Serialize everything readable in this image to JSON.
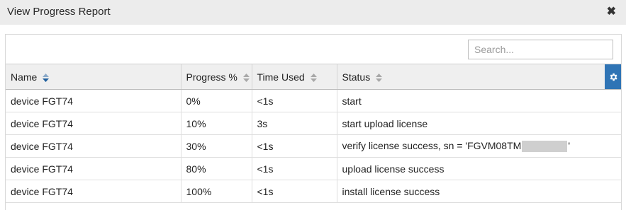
{
  "dialog": {
    "title": "View Progress Report",
    "close_glyph": "✖"
  },
  "search": {
    "placeholder": "Search..."
  },
  "table": {
    "columns": [
      "Name",
      "Progress %",
      "Time Used",
      "Status"
    ],
    "rows": [
      {
        "name": "device FGT74",
        "progress": "0%",
        "time": "<1s",
        "status": "start"
      },
      {
        "name": "device FGT74",
        "progress": "10%",
        "time": "3s",
        "status": "start upload license"
      },
      {
        "name": "device FGT74",
        "progress": "30%",
        "time": "<1s",
        "status_prefix": "verify license success, sn = 'FGVM08TM",
        "status_suffix": "'"
      },
      {
        "name": "device FGT74",
        "progress": "80%",
        "time": "<1s",
        "status": "upload license success"
      },
      {
        "name": "device FGT74",
        "progress": "100%",
        "time": "<1s",
        "status": "install license success"
      }
    ]
  },
  "icons": {
    "close": "close-icon",
    "settings": "gear-icon",
    "sort_active": "sort-asc-desc-icon",
    "sort": "sort-icon"
  },
  "colors": {
    "accent": "#2f74b5",
    "header_bg": "#efefef",
    "titlebar_bg": "#ececec"
  }
}
